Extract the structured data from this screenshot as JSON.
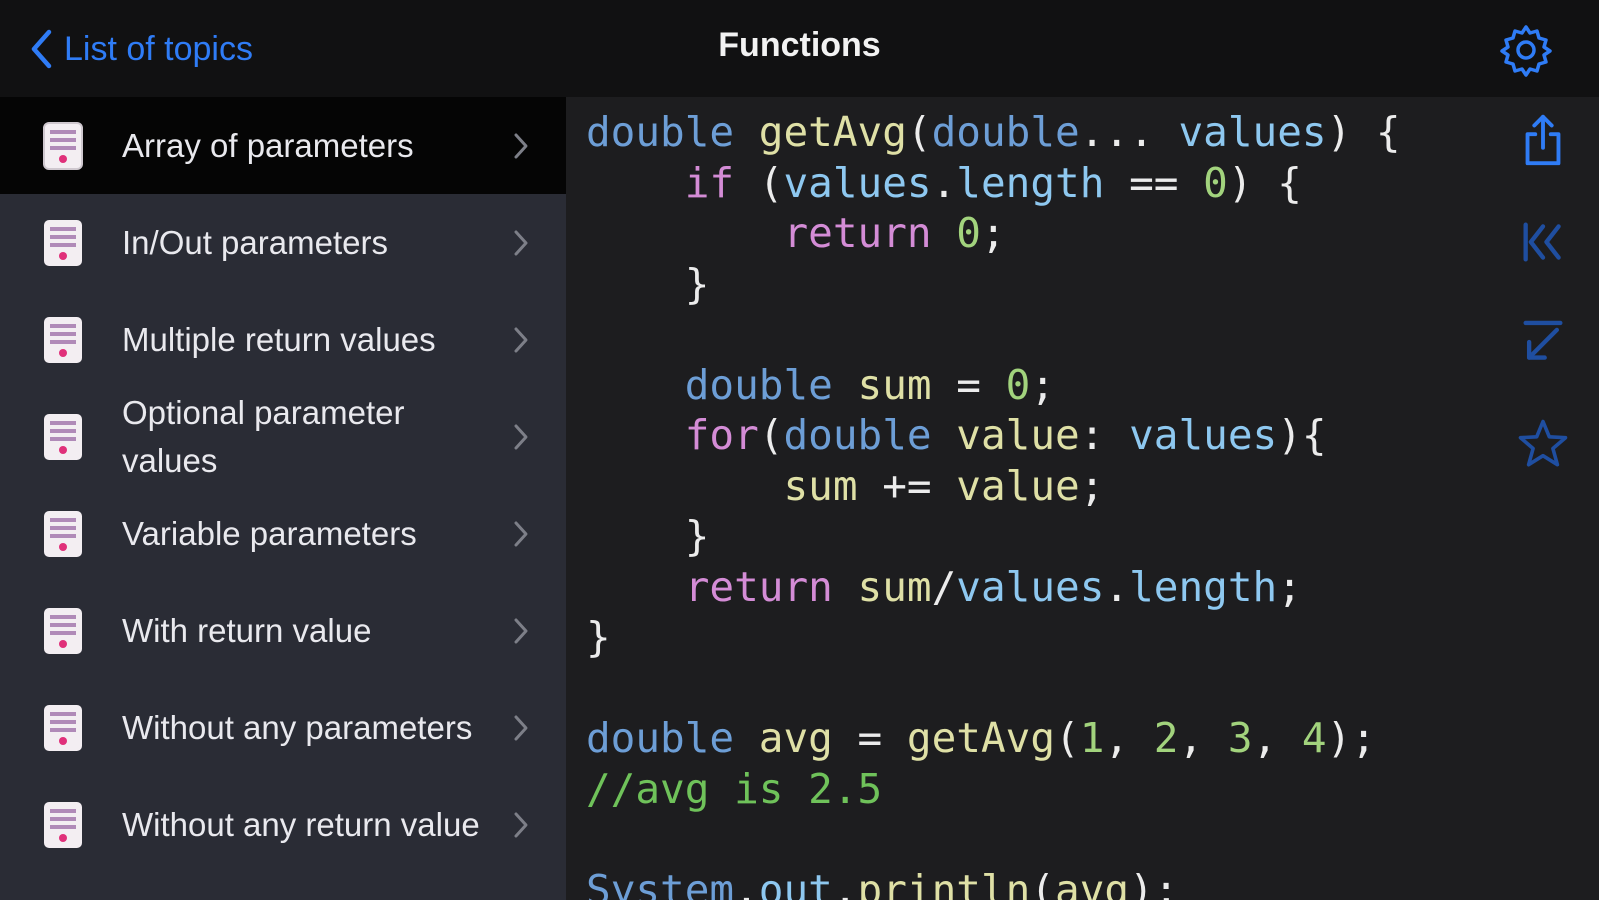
{
  "header": {
    "back_label": "List of topics",
    "title": "Functions"
  },
  "colors": {
    "accent": "#2f7cf6",
    "sidebar_bg": "#2a2c35",
    "selected_bg": "#050505",
    "code_bg": "#1d1d1f"
  },
  "sidebar": {
    "items": [
      {
        "label": "Array of parameters",
        "selected": true
      },
      {
        "label": "In/Out parameters"
      },
      {
        "label": "Multiple return values"
      },
      {
        "label": "Optional parameter values"
      },
      {
        "label": "Variable parameters"
      },
      {
        "label": "With return value"
      },
      {
        "label": "Without any parameters"
      },
      {
        "label": "Without any return value"
      }
    ]
  },
  "code": {
    "lines": [
      "double getAvg(double... values) {",
      "    if (values.length == 0) {",
      "        return 0;",
      "    }",
      "",
      "    double sum = 0;",
      "    for(double value: values){",
      "        sum += value;",
      "    }",
      "    return sum/values.length;",
      "}",
      "",
      "double avg = getAvg(1, 2, 3, 4);",
      "//avg is 2.5",
      "",
      "System.out.println(avg);"
    ]
  },
  "toolbar": {
    "icons": [
      "share-icon",
      "first-icon",
      "last-icon",
      "star-icon"
    ]
  }
}
